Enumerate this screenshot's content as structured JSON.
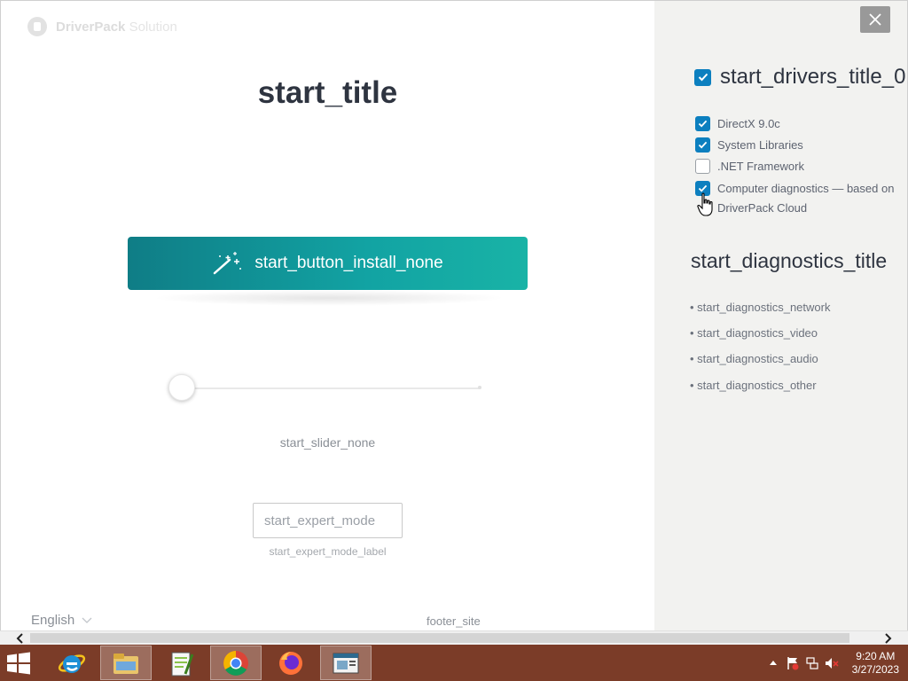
{
  "app": {
    "logo_text": "DriverPack",
    "logo_text_suffix": "Solution",
    "title": "start_title",
    "install_button_label": "start_button_install_none",
    "slider_label": "start_slider_none",
    "slider_value": 0,
    "expert_mode_placeholder": "start_expert_mode",
    "expert_mode_label": "start_expert_mode_label",
    "language": "English",
    "footer_site": "footer_site"
  },
  "panel": {
    "drivers_title": "start_drivers_title_0",
    "drivers_title_checked": true,
    "options": [
      {
        "label": "DirectX 9.0c",
        "checked": true
      },
      {
        "label": "System Libraries",
        "checked": true
      },
      {
        "label": ".NET Framework",
        "checked": false
      },
      {
        "label": "Computer diagnostics — based on DriverPack Cloud",
        "checked": true
      }
    ],
    "diagnostics_title": "start_diagnostics_title",
    "diagnostics_items": [
      "• start_diagnostics_network",
      "• start_diagnostics_video",
      "• start_diagnostics_audio",
      "• start_diagnostics_other"
    ]
  },
  "taskbar": {
    "apps": [
      "internet-explorer",
      "file-explorer",
      "notepad-plus-plus",
      "chrome",
      "firefox",
      "driverpack"
    ],
    "active_app": "driverpack",
    "time": "9:20 AM",
    "date": "3/27/2023"
  },
  "colors": {
    "accent": "#0c7fbf",
    "button_start": "#0f7d86",
    "button_end": "#19b3a6",
    "taskbar": "#7b3c28"
  }
}
